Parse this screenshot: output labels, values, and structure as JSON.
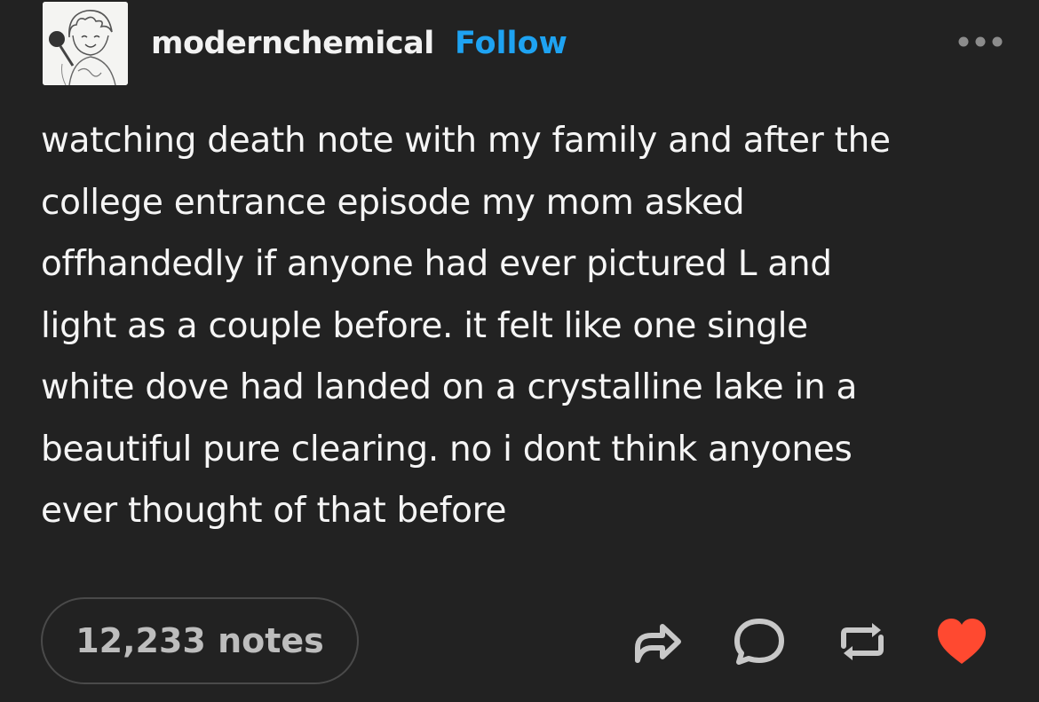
{
  "post": {
    "username": "modernchemical",
    "follow_label": "Follow",
    "more_icon": "ellipsis-icon",
    "body": "watching death note with my family and after the\ncollege entrance episode my mom asked\noffhandedly if anyone had ever pictured L and\nlight as a couple before. it felt like one single\nwhite dove had landed on a crystalline lake in a\nbeautiful pure clearing. no i dont think anyones\never thought of that before",
    "notes_label": "12,233 notes"
  },
  "actions": [
    {
      "name": "share",
      "icon": "share-arrow-icon"
    },
    {
      "name": "reply",
      "icon": "speech-bubble-icon"
    },
    {
      "name": "reblog",
      "icon": "reblog-icon"
    },
    {
      "name": "like",
      "icon": "heart-icon",
      "state": "liked"
    }
  ],
  "colors": {
    "background": "#222222",
    "follow": "#1ea3f2",
    "heart": "#ff4930",
    "text": "#f5f5f5",
    "muted": "#bdbdbd"
  }
}
